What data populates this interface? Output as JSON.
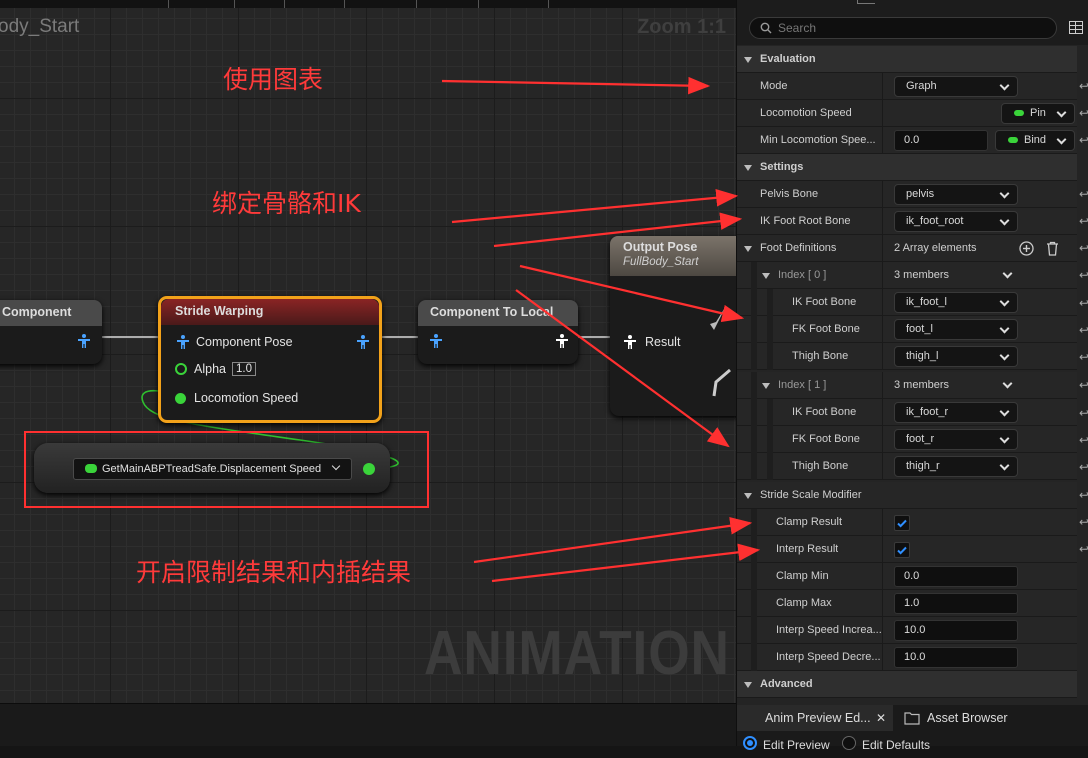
{
  "graph": {
    "title": "ody_Start",
    "zoom": "Zoom 1:1",
    "watermark": "ANIMATION",
    "nodes": {
      "component": {
        "title": "Component"
      },
      "stride_warping": {
        "title": "Stride Warping",
        "pins": {
          "component_pose": "Component Pose",
          "alpha": "Alpha",
          "alpha_value": "1.0",
          "locomotion_speed": "Locomotion Speed"
        }
      },
      "component_to_local": {
        "title": "Component To Local"
      },
      "output_pose": {
        "title": "Output Pose",
        "subtitle": "FullBody_Start",
        "result": "Result"
      },
      "getter": {
        "label": "GetMainABPTreadSafe.Displacement Speed"
      }
    },
    "annotations": {
      "use_graph": "使用图表",
      "bind_bones": "绑定骨骼和IK",
      "enable_clamp": "开启限制结果和内插结果"
    }
  },
  "details": {
    "search_placeholder": "Search",
    "evaluation": {
      "header": "Evaluation",
      "mode_label": "Mode",
      "mode_value": "Graph",
      "loco_speed_label": "Locomotion Speed",
      "loco_speed_value": "Pin",
      "min_loco_label": "Min Locomotion Spee...",
      "min_loco_value": "0.0",
      "min_loco_bind": "Bind"
    },
    "settings": {
      "header": "Settings",
      "pelvis_label": "Pelvis Bone",
      "pelvis_value": "pelvis",
      "ik_root_label": "IK Foot Root Bone",
      "ik_root_value": "ik_foot_root",
      "foot_defs_label": "Foot Definitions",
      "foot_defs_value": "2 Array elements",
      "index0": {
        "label": "Index [ 0 ]",
        "value": "3 members",
        "ik_label": "IK Foot Bone",
        "ik_value": "ik_foot_l",
        "fk_label": "FK Foot Bone",
        "fk_value": "foot_l",
        "thigh_label": "Thigh Bone",
        "thigh_value": "thigh_l"
      },
      "index1": {
        "label": "Index [ 1 ]",
        "value": "3 members",
        "ik_label": "IK Foot Bone",
        "ik_value": "ik_foot_r",
        "fk_label": "FK Foot Bone",
        "fk_value": "foot_r",
        "thigh_label": "Thigh Bone",
        "thigh_value": "thigh_r"
      }
    },
    "stride": {
      "header": "Stride Scale Modifier",
      "clamp_result_label": "Clamp Result",
      "clamp_result_checked": true,
      "interp_result_label": "Interp Result",
      "interp_result_checked": true,
      "clamp_min_label": "Clamp Min",
      "clamp_min_value": "0.0",
      "clamp_max_label": "Clamp Max",
      "clamp_max_value": "1.0",
      "interp_inc_label": "Interp Speed Increa...",
      "interp_inc_value": "10.0",
      "interp_dec_label": "Interp Speed Decre...",
      "interp_dec_value": "10.0"
    },
    "advanced": {
      "header": "Advanced"
    },
    "tabs": {
      "anim_preview": "Anim Preview Ed...",
      "asset_browser": "Asset Browser",
      "edit_preview": "Edit Preview",
      "edit_defaults": "Edit Defaults"
    }
  },
  "colors": {
    "annotation": "#ff3a3a",
    "pin_green": "#3ad43a",
    "stride_header": "#7a1f1f",
    "selection_orange": "#f2a21a",
    "checkbox_blue": "#2f8fff"
  }
}
